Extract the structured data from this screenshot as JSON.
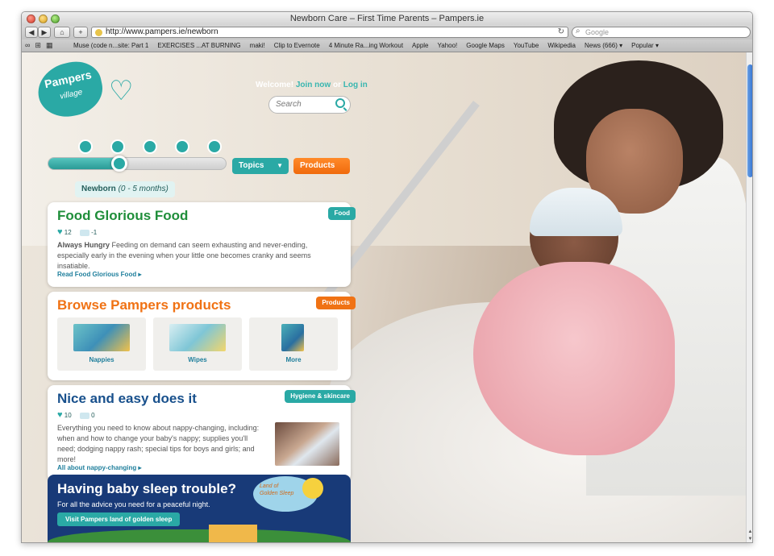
{
  "window": {
    "title": "Newborn Care – First Time Parents – Pampers.ie"
  },
  "toolbar": {
    "back_label": "◀",
    "forward_label": "▶",
    "url": "http://www.pampers.ie/newborn",
    "reload_icon": "↻",
    "search_placeholder": "Google"
  },
  "bookmarks": [
    "Muse (code n...site: Part 1",
    "EXERCISES ...AT BURNING",
    "maki!",
    "Clip to Evernote",
    "4 Minute Ra...ing Workout",
    "Apple",
    "Yahoo!",
    "Google Maps",
    "YouTube",
    "Wikipedia",
    "News (666) ▾",
    "Popular ▾"
  ],
  "site": {
    "logo_text": "Pampers",
    "logo_sub": "village",
    "welcome_prefix": "Welcome!",
    "join_label": "Join now",
    "or_label": "or",
    "login_label": "Log in",
    "search_placeholder": "Search",
    "topics_label": "Topics",
    "products_label": "Products",
    "stage_label": "Newborn",
    "stage_range": "(0 - 5 months)",
    "slider_position": 0.4
  },
  "cards": {
    "food": {
      "title": "Food Glorious Food",
      "tag": "Food",
      "likes": "12",
      "comments": "-1",
      "bold_intro": "Always Hungry",
      "text": "Feeding on demand can seem exhausting and never-ending, especially early in the evening when your little one becomes cranky and seems insatiable.",
      "link": "Read Food Glorious Food"
    },
    "products": {
      "title": "Browse Pampers products",
      "tag": "Products",
      "items": [
        {
          "label": "Nappies"
        },
        {
          "label": "Wipes"
        },
        {
          "label": "More"
        }
      ]
    },
    "hygiene": {
      "title": "Nice and easy does it",
      "tag": "Hygiene & skincare",
      "likes": "10",
      "comments": "0",
      "text": "Everything you need to know about nappy-changing, including: when and how to change your baby's nappy; supplies you'll need; dodging nappy rash; special tips for boys and girls; and more!",
      "link": "All about nappy-changing"
    },
    "sleep": {
      "title": "Having baby sleep trouble?",
      "subtitle": "For all the advice you need for a peaceful night.",
      "button": "Visit Pampers land of golden sleep",
      "badge_line1": "Land of",
      "badge_line2": "Golden Sleep"
    }
  },
  "colors": {
    "teal": "#2aa9a5",
    "orange": "#f07214",
    "navy": "#183a78"
  }
}
